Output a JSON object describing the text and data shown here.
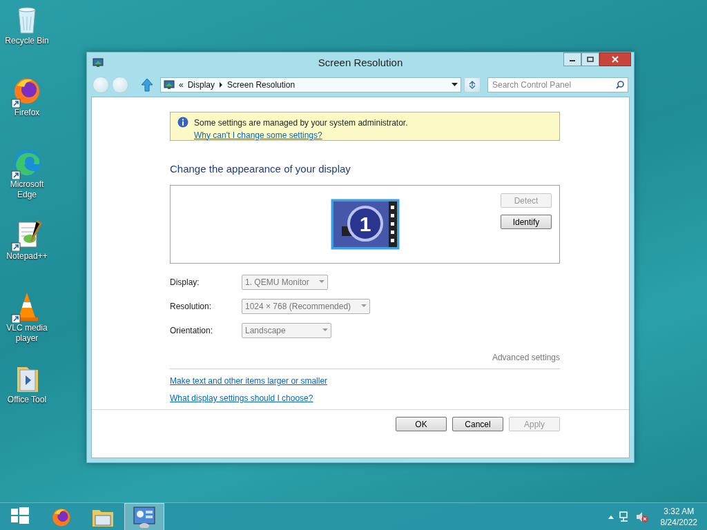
{
  "desktop_icons": [
    {
      "kind": "recycle",
      "label": "Recycle Bin"
    },
    {
      "kind": "firefox",
      "label": "Firefox"
    },
    {
      "kind": "edge",
      "label": "Microsoft Edge"
    },
    {
      "kind": "notepad",
      "label": "Notepad++"
    },
    {
      "kind": "vlc",
      "label": "VLC media player"
    },
    {
      "kind": "folder",
      "label": "Office Tool"
    }
  ],
  "window": {
    "title": "Screen Resolution",
    "address": {
      "prefix": "«",
      "path": [
        "Display",
        "Screen Resolution"
      ]
    },
    "search": {
      "placeholder": "Search Control Panel"
    },
    "notice": {
      "message": "Some settings are managed by your system administrator.",
      "link": "Why can't I change some settings?"
    },
    "heading": "Change the appearance of your display",
    "monitor": {
      "number": "1"
    },
    "monitor_buttons": [
      {
        "label": "Detect",
        "disabled": true
      },
      {
        "label": "Identify",
        "disabled": false
      }
    ],
    "settings": [
      {
        "label": "Display:",
        "value": "1. QEMU Monitor",
        "disabled": true
      },
      {
        "label": "Resolution:",
        "value": "1024 × 768 (Recommended)",
        "disabled": true
      },
      {
        "label": "Orientation:",
        "value": "Landscape",
        "disabled": true
      }
    ],
    "advanced_link": "Advanced settings",
    "links": [
      "Make text and other items larger or smaller",
      "What display settings should I choose?"
    ],
    "buttons": [
      {
        "label": "OK",
        "disabled": false
      },
      {
        "label": "Cancel",
        "disabled": false
      },
      {
        "label": "Apply",
        "disabled": true
      }
    ]
  },
  "taskbar": {
    "items": [
      {
        "kind": "start",
        "selected": false
      },
      {
        "kind": "firefox",
        "selected": false
      },
      {
        "kind": "explorer",
        "selected": false
      },
      {
        "kind": "control-panel",
        "selected": true
      }
    ],
    "time": "3:32 AM",
    "date": "8/24/2022"
  }
}
